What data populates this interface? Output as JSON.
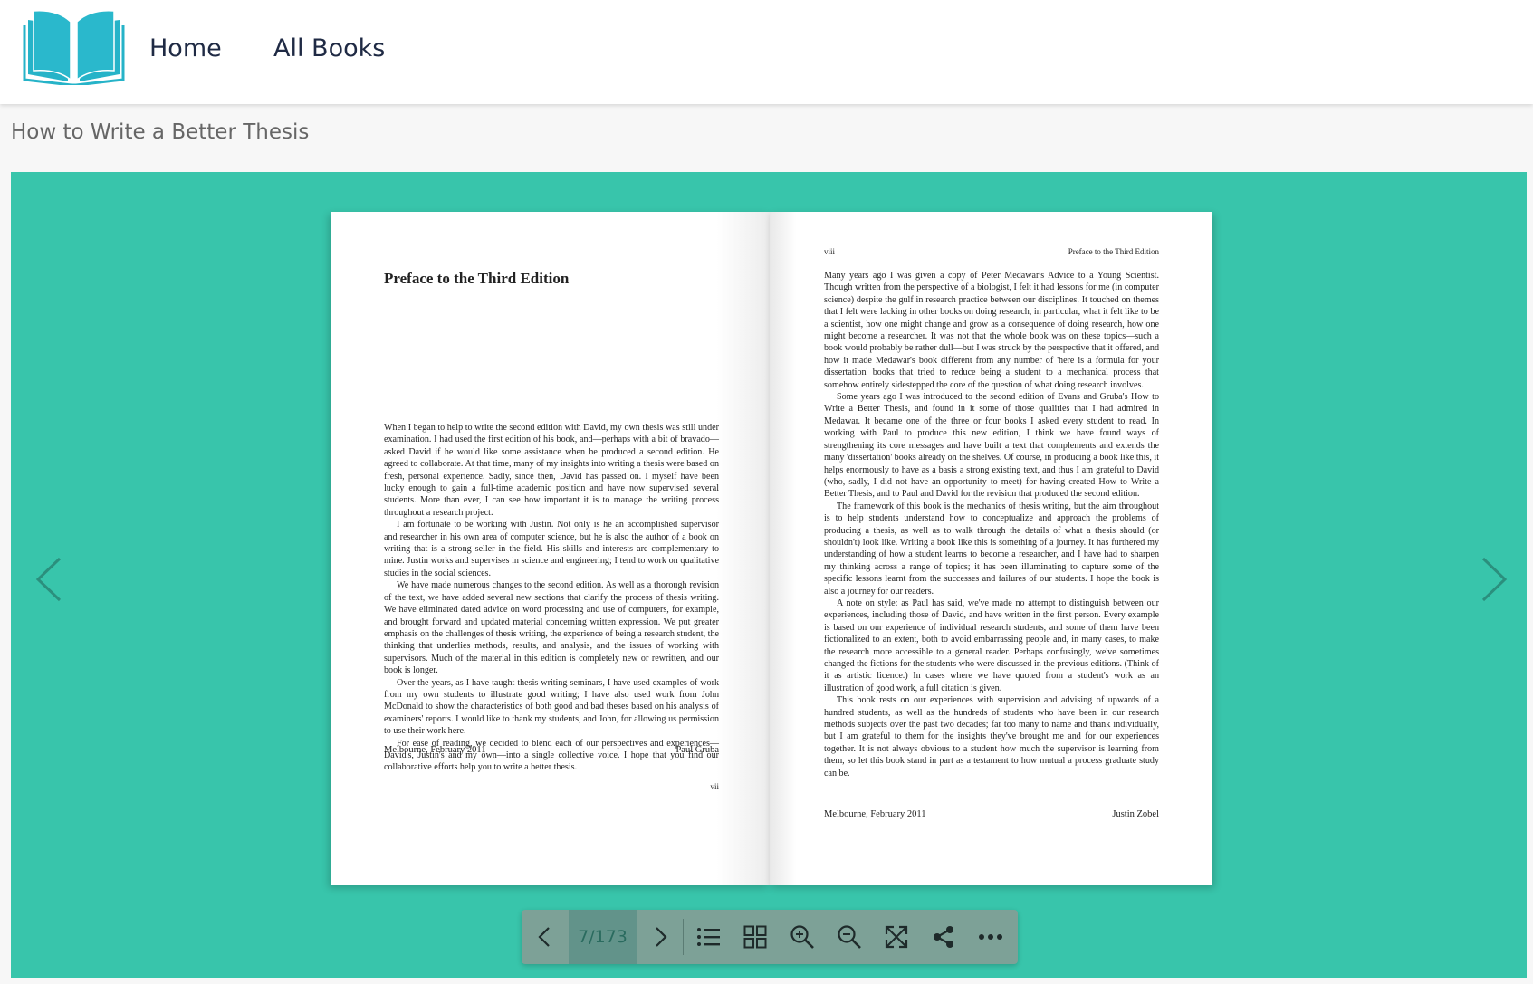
{
  "nav": {
    "logo_icon": "open-book-logo",
    "home_label": "Home",
    "all_books_label": "All Books"
  },
  "page_title": "How to Write a Better Thesis",
  "colors": {
    "stage": "#38c5ab",
    "logo": "#26b3c8",
    "toolbar": "#7da197"
  },
  "viewer": {
    "left_page": {
      "heading": "Preface to the Third Edition",
      "paragraphs": [
        "When I began to help to write the second edition with David, my own thesis was still under examination. I had used the first edition of his book, and—perhaps with a bit of bravado—asked David if he would like some assistance when he produced a second edition. He agreed to collaborate. At that time, many of my insights into writing a thesis were based on fresh, personal experience. Sadly, since then, David has passed on. I myself have been lucky enough to gain a full-time academic position and have now supervised several students. More than ever, I can see how important it is to manage the writing process throughout a research project.",
        "I am fortunate to be working with Justin. Not only is he an accomplished supervisor and researcher in his own area of computer science, but he is also the author of a book on writing that is a strong seller in the field. His skills and interests are complementary to mine. Justin works and supervises in science and engineering; I tend to work on qualitative studies in the social sciences.",
        "We have made numerous changes to the second edition. As well as a thorough revision of the text, we have added several new sections that clarify the process of thesis writing. We have eliminated dated advice on word processing and use of computers, for example, and brought forward and updated material concerning written expression. We put greater emphasis on the challenges of thesis writing, the experience of being a research student, the thinking that underlies methods, results, and analysis, and the issues of working with supervisors. Much of the material in this edition is completely new or rewritten, and our book is longer.",
        "Over the years, as I have taught thesis writing seminars, I have used examples of work from my own students to illustrate good writing; I have also used work from John McDonald to show the characteristics of both good and bad theses based on his analysis of examiners' reports. I would like to thank my students, and John, for allowing us permission to use their work here.",
        "For ease of reading, we decided to blend each of our perspectives and experiences—David's, Justin's and my own—into a single collective voice. I hope that you find our collaborative efforts help you to write a better thesis."
      ],
      "place_date": "Melbourne, February 2011",
      "author": "Paul Gruba",
      "folio": "vii"
    },
    "right_page": {
      "folio": "viii",
      "running_head": "Preface to the Third Edition",
      "paragraphs": [
        "Many years ago I was given a copy of Peter Medawar's Advice to a Young Scientist. Though written from the perspective of a biologist, I felt it had lessons for me (in computer science) despite the gulf in research practice between our disciplines. It touched on themes that I felt were lacking in other books on doing research, in particular, what it felt like to be a scientist, how one might change and grow as a consequence of doing research, how one might become a researcher. It was not that the whole book was on these topics—such a book would probably be rather dull—but I was struck by the perspective that it offered, and how it made Medawar's book different from any number of 'here is a formula for your dissertation' books that tried to reduce being a student to a mechanical process that somehow entirely sidestepped the core of the question of what doing research involves.",
        "Some years ago I was introduced to the second edition of Evans and Gruba's How to Write a Better Thesis, and found in it some of those qualities that I had admired in Medawar. It became one of the three or four books I asked every student to read. In working with Paul to produce this new edition, I think we have found ways of strengthening its core messages and have built a text that complements and extends the many 'dissertation' books already on the shelves. Of course, in producing a book like this, it helps enormously to have as a basis a strong existing text, and thus I am grateful to David (who, sadly, I did not have an opportunity to meet) for having created How to Write a Better Thesis, and to Paul and David for the revision that produced the second edition.",
        "The framework of this book is the mechanics of thesis writing, but the aim throughout is to help students understand how to conceptualize and approach the problems of producing a thesis, as well as to walk through the details of what a thesis should (or shouldn't) look like. Writing a book like this is something of a journey. It has furthered my understanding of how a student learns to become a researcher, and I have had to sharpen my thinking across a range of topics; it has been illuminating to capture some of the specific lessons learnt from the successes and failures of our students. I hope the book is also a journey for our readers.",
        "A note on style: as Paul has said, we've made no attempt to distinguish between our experiences, including those of David, and have written in the first person. Every example is based on our experience of individual research students, and some of them have been fictionalized to an extent, both to avoid embarrassing people and, in many cases, to make the research more accessible to a general reader. Perhaps confusingly, we've sometimes changed the fictions for the students who were discussed in the previous editions. (Think of it as artistic licence.) In cases where we have quoted from a student's work as an illustration of good work, a full citation is given.",
        "This book rests on our experiences with supervision and advising of upwards of a hundred students, as well as the hundreds of students who have been in our research methods subjects over the past two decades; far too many to name and thank individually, but I am grateful to them for the insights they've brought me and for our experiences together. It is not always obvious to a student how much the supervisor is learning from them, so let this book stand in part as a testament to how mutual a process graduate study can be."
      ],
      "place_date": "Melbourne, February 2011",
      "author": "Justin Zobel"
    }
  },
  "toolbar": {
    "page_indicator": "7/173",
    "buttons": [
      "prev-page",
      "next-page",
      "table-of-contents",
      "thumbnails",
      "zoom-in",
      "zoom-out",
      "fullscreen",
      "share",
      "more"
    ]
  }
}
